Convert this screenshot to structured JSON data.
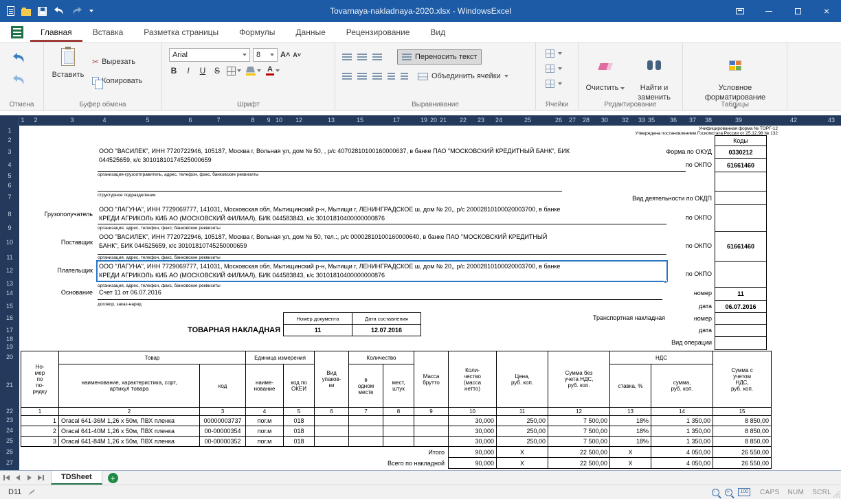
{
  "titlebar": {
    "title": "Tovarnaya-nakladnaya-2020.xlsx - WindowsExcel"
  },
  "ribbon": {
    "tabs": [
      "Главная",
      "Вставка",
      "Разметка страницы",
      "Формулы",
      "Данные",
      "Рецензирование",
      "Вид"
    ],
    "active_tab": "Главная",
    "undo_group_label": "Отмена",
    "clipboard": {
      "label": "Буфер обмена",
      "paste": "Вставить",
      "cut": "Вырезать",
      "copy": "Копировать"
    },
    "font": {
      "label": "Шрифт",
      "family": "Arial",
      "size": "8",
      "bold": "B",
      "italic": "I",
      "underline": "U",
      "strike": "S",
      "color_letter": "А",
      "grow": "А",
      "shrink": "А"
    },
    "alignment": {
      "label": "Выравнивание",
      "wrap": "Переносить текст",
      "merge": "Объединить ячейки"
    },
    "cells": {
      "label": "Ячейки"
    },
    "editing": {
      "label": "Редактирование",
      "clear": "Очистить",
      "find": "Найти и\nзаменить"
    },
    "tables": {
      "label": "Таблицы",
      "conditional": "Условное\nформатирование"
    }
  },
  "grid": {
    "col_headers": [
      "1",
      "2",
      "3",
      "4",
      "5",
      "6",
      "7",
      "8",
      "9",
      "10",
      "12",
      "13",
      "15",
      "17",
      "19",
      "20",
      "21",
      "22",
      "23",
      "24",
      "25",
      "26",
      "27",
      "28",
      "30",
      "32",
      "33",
      "35",
      "36",
      "37",
      "38",
      "39",
      "42",
      "43"
    ],
    "row_headers": [
      "1",
      "2",
      "3",
      "4",
      "5",
      "6",
      "7",
      "8",
      "9",
      "10",
      "11",
      "12",
      "13",
      "14",
      "15",
      "16",
      "17",
      "18",
      "19",
      "20",
      "21",
      "22",
      "23",
      "24",
      "25",
      "26",
      "27"
    ]
  },
  "form": {
    "note_line1": "Унифицированная форма № ТОРГ-12",
    "note_line2": "Утверждена постановлением Госкомстата России от 25.12.98 № 132",
    "codes_header": "Коды",
    "okud_label": "Форма по ОКУД",
    "okud_value": "0330212",
    "okpo_label": "по ОКПО",
    "shipper_text": "ООО \"ВАСИЛЕК\", ИНН 7720722946, 105187, Москва г, Вольная ул, дом № 50, , р/с 40702810100160000637, в банке ПАО \"МОСКОВСКИЙ КРЕДИТНЫЙ БАНК\", БИК\n044525659, к/с 30101810174525000659",
    "shipper_okpo": "61661460",
    "shipper_caption": "организация-грузоотправитель, адрес, телефон, факс, банковские реквизиты",
    "division_caption": "структурное подразделение",
    "activity_label": "Вид деятельности по ОКДП",
    "consignee_label": "Грузополучатель",
    "consignee_text": "ООО \"ЛАГУНА\", ИНН 7729069777, 141031, Московская обл, Мытищинский р-н, Мытищи г, ЛЕНИНГРАДСКОЕ ш, дом № 20,, р/с 20002810100020003700, в банке\nКРЕДИ АГРИКОЛЬ КИБ АО (МОСКОВСКИЙ ФИЛИАЛ), БИК 044583843, к/с 30101810400000000876",
    "org_caption1": "организация, адрес, телефон, факс, банковские реквизиты",
    "supplier_label": "Поставщик",
    "supplier_text": "ООО \"ВАСИЛЕК\", ИНН 7720722946, 105187, Москва г, Вольная ул, дом № 50, тел.:, р/с 00002810100160000640, в банке ПАО \"МОСКОВСКИЙ КРЕДИТНЫЙ\nБАНК\", БИК 044525659, к/с 30101810745250000659",
    "supplier_okpo": "61661460",
    "org_caption2": "организация, адрес, телефон, факс, банковские реквизиты",
    "payer_label": "Плательщик",
    "payer_text": "ООО \"ЛАГУНА\", ИНН 7729069777, 141031, Московская обл, Мытищинский р-н, Мытищи г, ЛЕНИНГРАДСКОЕ ш, дом № 20,, р/с 20002810100020003700, в банке\nКРЕДИ АГРИКОЛЬ КИБ АО (МОСКОВСКИЙ ФИЛИАЛ), БИК 044583843, к/с 30101810400000000876",
    "org_caption3": "организация, адрес, телефон, факс, банковские реквизиты",
    "basis_label": "Основание",
    "basis_value": "Счет 11 от 06.07.2016",
    "basis_caption": "договор, заказ-наряд",
    "number_label": "номер",
    "basis_number": "11",
    "date_label": "дата",
    "basis_date": "06.07.2016",
    "doc_number_header": "Номер документа",
    "doc_date_header": "Дата составления",
    "doc_title": "ТОВАРНАЯ НАКЛАДНАЯ",
    "doc_number": "11",
    "doc_date": "12.07.2016",
    "transport_label": "Транспортная накладная",
    "transport_number_label": "номер",
    "transport_date_label": "дата",
    "operation_label": "Вид операции"
  },
  "items": {
    "header": {
      "num": "Но-\nмер\nпо\nпо-\nрядку",
      "tovar": "Товар",
      "name": "наименование, характеристика, сорт,\nартикул товара",
      "code": "код",
      "unit": "Единица измерения",
      "unit_name": "наиме-\nнование",
      "unit_okei": "код по\nОКЕИ",
      "pack": "Вид\nупаков-\nки",
      "qty": "Количество",
      "qty_one": "в\nодном\nместе",
      "qty_places": "мест,\nштук",
      "gross": "Масса\nбрутто",
      "qty_net": "Коли-\nчество\n(масса\nнетто)",
      "price": "Цена,\nруб. коп.",
      "sum_no_vat": "Сумма без\nучета НДС,\nруб. коп.",
      "vat": "НДС",
      "vat_rate": "ставка, %",
      "vat_sum": "сумма,\nруб. коп.",
      "sum_with_vat": "Сумма с\nучетом\nНДС,\nруб. коп."
    },
    "col_numbers": [
      "1",
      "2",
      "3",
      "4",
      "5",
      "6",
      "7",
      "8",
      "9",
      "10",
      "11",
      "12",
      "13",
      "14",
      "15"
    ],
    "rows": [
      {
        "n": "1",
        "name": "Oracal 641-36M 1,26 х 50м, ПВХ пленка",
        "code": "00000003737",
        "unit": "пог.м",
        "okei": "018",
        "pack": "",
        "per_place": "",
        "places": "",
        "gross": "",
        "qty": "30,000",
        "price": "250,00",
        "sum": "7 500,00",
        "rate": "18%",
        "vat": "1 350,00",
        "total": "8 850,00"
      },
      {
        "n": "2",
        "name": "Oracal 641-40M 1,26 х 50м, ПВХ пленка",
        "code": "00-00000354",
        "unit": "пог.м",
        "okei": "018",
        "pack": "",
        "per_place": "",
        "places": "",
        "gross": "",
        "qty": "30,000",
        "price": "250,00",
        "sum": "7 500,00",
        "rate": "18%",
        "vat": "1 350,00",
        "total": "8 850,00"
      },
      {
        "n": "3",
        "name": "Oracal 641-84M 1,26 х 50м, ПВХ пленка",
        "code": "00-00000352",
        "unit": "пог.м",
        "okei": "018",
        "pack": "",
        "per_place": "",
        "places": "",
        "gross": "",
        "qty": "30,000",
        "price": "250,00",
        "sum": "7 500,00",
        "rate": "18%",
        "vat": "1 350,00",
        "total": "8 850,00"
      }
    ],
    "itogo_label": "Итого",
    "itogo": {
      "qty": "90,000",
      "price_x": "X",
      "sum": "22 500,00",
      "rate_x": "X",
      "vat": "4 050,00",
      "total": "26 550,00"
    },
    "vsego_label": "Всего по накладной",
    "vsego": {
      "qty": "90,000",
      "price_x": "X",
      "sum": "22 500,00",
      "rate_x": "X",
      "vat": "4 050,00",
      "total": "26 550,00"
    }
  },
  "sheet_tabs": {
    "active": "TDSheet"
  },
  "status": {
    "cell_ref": "D11",
    "zoom_value": "100",
    "indicators": [
      "CAPS",
      "NUM",
      "SCRL"
    ]
  }
}
